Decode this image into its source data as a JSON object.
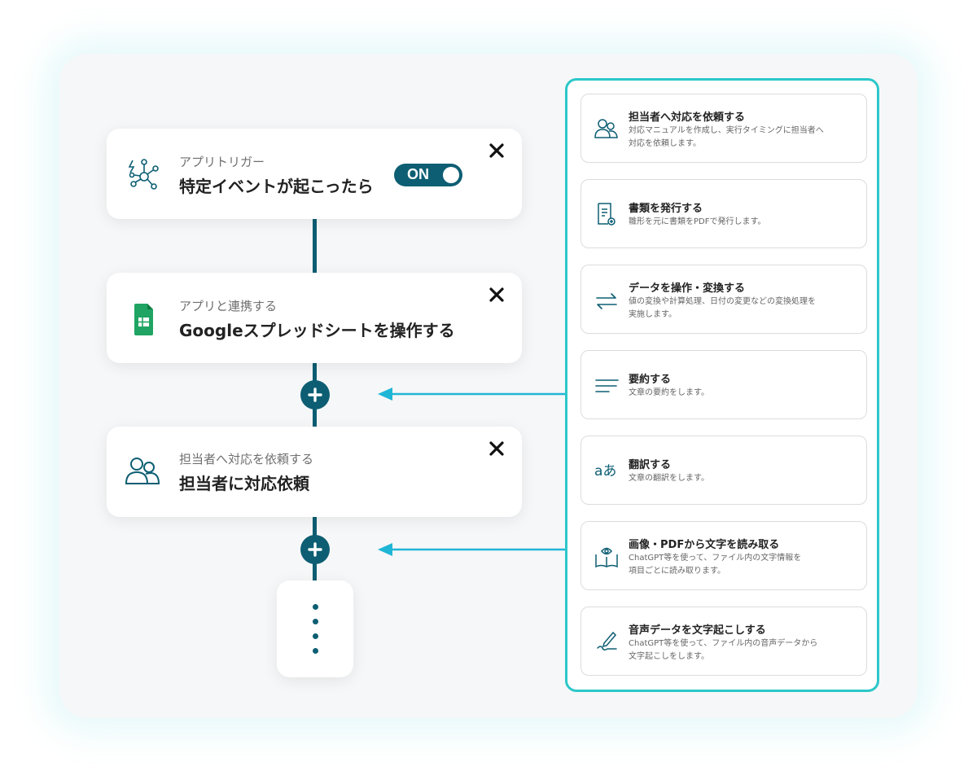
{
  "flow": {
    "trigger": {
      "subtitle": "アプリトリガー",
      "title": "特定イベントが起こったら",
      "toggle_label": "ON"
    },
    "app": {
      "subtitle": "アプリと連携する",
      "title": "Googleスプレッドシートを操作する"
    },
    "assign": {
      "subtitle": "担当者へ対応を依頼する",
      "title": "担当者に対応依頼"
    }
  },
  "colors": {
    "accent": "#0d5e73",
    "menu_border": "#2cc7c9",
    "arrow": "#1fb6d6",
    "sheets_green": "#1fa463"
  },
  "menu": {
    "items": [
      {
        "icon": "people-icon",
        "title": "担当者へ対応を依頼する",
        "desc1": "対応マニュアルを作成し、実行タイミングに担当者へ",
        "desc2": "対応を依頼します。"
      },
      {
        "icon": "document-icon",
        "title": "書類を発行する",
        "desc1": "雛形を元に書類をPDFで発行します。",
        "desc2": ""
      },
      {
        "icon": "transform-arrows-icon",
        "title": "データを操作・変換する",
        "desc1": "値の変換や計算処理、日付の変更などの変換処理を",
        "desc2": "実施します。"
      },
      {
        "icon": "summary-lines-icon",
        "title": "要約する",
        "desc1": "文章の要約をします。",
        "desc2": ""
      },
      {
        "icon": "translate-icon",
        "title": "翻訳する",
        "desc1": "文章の翻訳をします。",
        "desc2": ""
      },
      {
        "icon": "book-eye-icon",
        "title": "画像・PDFから文字を読み取る",
        "desc1": "ChatGPT等を使って、ファイル内の文字情報を",
        "desc2": "項目ごとに読み取ります。"
      },
      {
        "icon": "pen-icon",
        "title": "音声データを文字起こしする",
        "desc1": "ChatGPT等を使って、ファイル内の音声データから",
        "desc2": "文字起こしをします。"
      }
    ]
  }
}
